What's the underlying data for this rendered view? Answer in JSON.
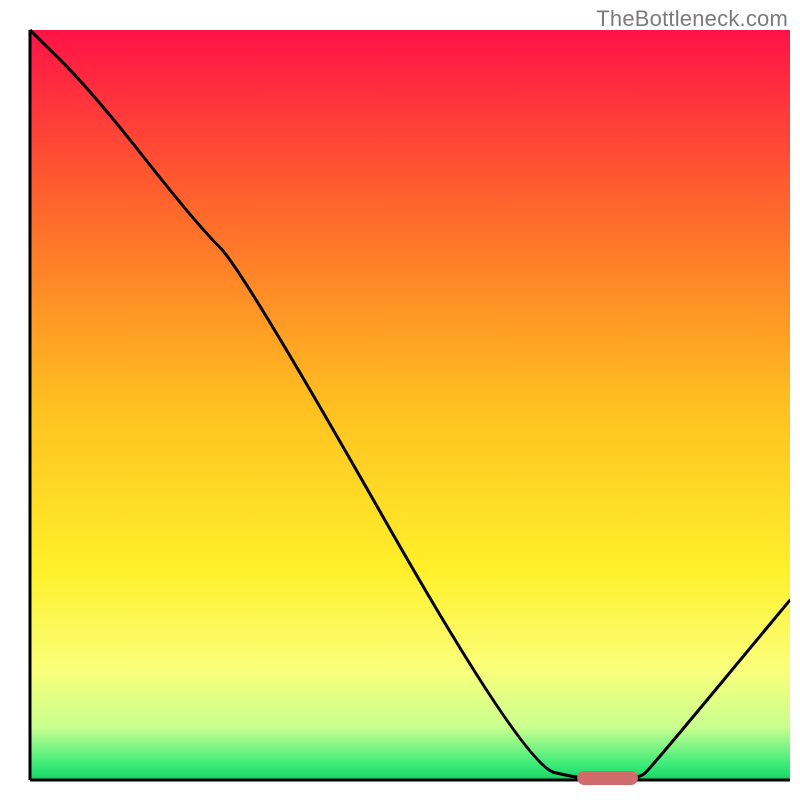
{
  "watermark": "TheBottleneck.com",
  "chart_data": {
    "type": "line",
    "title": "",
    "xlabel": "",
    "ylabel": "",
    "xlim": [
      0,
      100
    ],
    "ylim": [
      0,
      100
    ],
    "axes_visible": {
      "left": true,
      "bottom": true,
      "top": false,
      "right": false
    },
    "gradient_stops": [
      {
        "offset": 0.0,
        "color": "#ff1247"
      },
      {
        "offset": 0.25,
        "color": "#ff6b2b"
      },
      {
        "offset": 0.5,
        "color": "#ffc020"
      },
      {
        "offset": 0.72,
        "color": "#fff02a"
      },
      {
        "offset": 0.85,
        "color": "#fbff7a"
      },
      {
        "offset": 0.93,
        "color": "#c9ff8f"
      },
      {
        "offset": 0.98,
        "color": "#3aeb78"
      },
      {
        "offset": 1.0,
        "color": "#16d466"
      }
    ],
    "series": [
      {
        "name": "bottleneck-curve",
        "x": [
          0,
          8,
          22,
          28,
          65,
          73,
          80,
          82,
          100
        ],
        "values": [
          100,
          92,
          74,
          68,
          2,
          0,
          0,
          2,
          24
        ]
      }
    ],
    "marker": {
      "name": "optimal-range",
      "x_start": 72,
      "x_end": 80,
      "y": 0,
      "color": "#d16a6a"
    }
  }
}
